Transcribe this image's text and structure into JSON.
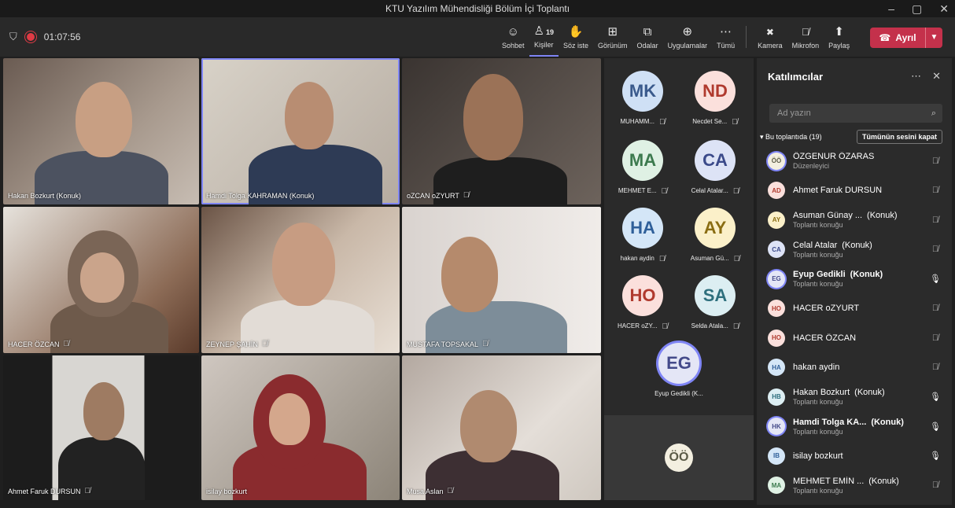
{
  "window": {
    "title": "KTU Yazılım Mühendisliği Bölüm İçi Toplantı"
  },
  "toolbar": {
    "timer": "01:07:56",
    "buttons": [
      {
        "label": "Sohbet",
        "icon": "chat-icon",
        "glyph": "☺"
      },
      {
        "label": "Kişiler",
        "icon": "people-icon",
        "glyph": "♙",
        "count": "19"
      },
      {
        "label": "Söz iste",
        "icon": "hand-icon",
        "glyph": "✋"
      },
      {
        "label": "Görünüm",
        "icon": "view-icon",
        "glyph": "⊞"
      },
      {
        "label": "Odalar",
        "icon": "rooms-icon",
        "glyph": "⧉"
      },
      {
        "label": "Uygulamalar",
        "icon": "apps-icon",
        "glyph": "⊕"
      },
      {
        "label": "Tümü",
        "icon": "more-icon",
        "glyph": "⋯"
      }
    ],
    "media": [
      {
        "label": "Kamera",
        "icon": "camera-off-icon",
        "glyph": "✖"
      },
      {
        "label": "Mikrofon",
        "icon": "mic-off-icon",
        "glyph": "🎙"
      },
      {
        "label": "Paylaş",
        "icon": "share-icon",
        "glyph": "⬆"
      }
    ],
    "leave": "Ayrıl"
  },
  "tiles": [
    {
      "name": "Hakan Bozkurt (Konuk)",
      "muted": false
    },
    {
      "name": "Hamdi Tolga KAHRAMAN (Konuk)",
      "muted": false
    },
    {
      "name": "oZCAN oZYURT",
      "muted": true
    },
    {
      "name": "HACER ÖZCAN",
      "muted": true
    },
    {
      "name": "ZEYNEP ŞAHİN",
      "muted": true
    },
    {
      "name": "MUSTAFA TOPSAKAL",
      "muted": true
    },
    {
      "name": "Ahmet Faruk DURSUN",
      "muted": true
    },
    {
      "name": "isilay bozkurt",
      "muted": false
    },
    {
      "name": "Musa Aslan",
      "muted": true
    }
  ],
  "avatars": [
    {
      "initials": "MK",
      "label": "MUHAMM...",
      "bg": "#cfe0f5",
      "fg": "#3a5a8c"
    },
    {
      "initials": "ND",
      "label": "Necdet Se...",
      "bg": "#fbe0dc",
      "fg": "#b03a2e"
    },
    {
      "initials": "MA",
      "label": "MEHMET E...",
      "bg": "#dff1e4",
      "fg": "#3c7a4e"
    },
    {
      "initials": "CA",
      "label": "Celal Atalar...",
      "bg": "#dde3f6",
      "fg": "#3b4a8a"
    },
    {
      "initials": "HA",
      "label": "hakan aydin",
      "bg": "#d4e6f7",
      "fg": "#2f5f99"
    },
    {
      "initials": "AY",
      "label": "Asuman Gü...",
      "bg": "#fbf0c9",
      "fg": "#8a6d12"
    },
    {
      "initials": "HO",
      "label": "HACER oZY...",
      "bg": "#fbe0dc",
      "fg": "#b03a2e"
    },
    {
      "initials": "SA",
      "label": "Selda Atala...",
      "bg": "#dceef2",
      "fg": "#2e6f7d"
    },
    {
      "initials": "EG",
      "label": "Eyup Gedikli (K...",
      "bg": "#e4e6f6",
      "fg": "#444a8a"
    }
  ],
  "self_tile": {
    "initials": "ÖÖ"
  },
  "panel": {
    "title": "Katılımcılar",
    "search_placeholder": "Ad yazın",
    "section_label": "Bu toplantıda (19)",
    "mute_all": "Tümünün sesini kapat",
    "participants": [
      {
        "initials": "ÖÖ",
        "name": "ÖZGENUR ÖZARAS",
        "tag": "",
        "role": "Düzenleyici",
        "bg": "#f3efe0",
        "fg": "#5b5b47",
        "mic": "muted",
        "bold": false
      },
      {
        "initials": "AD",
        "name": "Ahmet Faruk DURSUN",
        "tag": "",
        "role": "",
        "bg": "#fbe0dc",
        "fg": "#b03a2e",
        "mic": "muted",
        "bold": false
      },
      {
        "initials": "AY",
        "name": "Asuman Günay ...",
        "tag": "(Konuk)",
        "role": "Toplantı konuğu",
        "bg": "#fbf0c9",
        "fg": "#8a6d12",
        "mic": "muted",
        "bold": false
      },
      {
        "initials": "CA",
        "name": "Celal Atalar",
        "tag": "(Konuk)",
        "role": "Toplantı konuğu",
        "bg": "#dde3f6",
        "fg": "#3b4a8a",
        "mic": "muted",
        "bold": false
      },
      {
        "initials": "EG",
        "name": "Eyup Gedikli",
        "tag": "(Konuk)",
        "role": "Toplantı konuğu",
        "bg": "#e4e6f6",
        "fg": "#444a8a",
        "mic": "on",
        "bold": true
      },
      {
        "initials": "HO",
        "name": "HACER oZYURT",
        "tag": "",
        "role": "",
        "bg": "#fbe0dc",
        "fg": "#b03a2e",
        "mic": "muted",
        "bold": false
      },
      {
        "initials": "HO",
        "name": "HACER ÖZCAN",
        "tag": "",
        "role": "",
        "bg": "#fbe0dc",
        "fg": "#b03a2e",
        "mic": "muted",
        "bold": false
      },
      {
        "initials": "HA",
        "name": "hakan aydin",
        "tag": "",
        "role": "",
        "bg": "#d4e6f7",
        "fg": "#2f5f99",
        "mic": "muted",
        "bold": false
      },
      {
        "initials": "HB",
        "name": "Hakan Bozkurt",
        "tag": "(Konuk)",
        "role": "Toplantı konuğu",
        "bg": "#dceef2",
        "fg": "#2e6f7d",
        "mic": "on",
        "bold": false
      },
      {
        "initials": "HK",
        "name": "Hamdi Tolga KA...",
        "tag": "(Konuk)",
        "role": "Toplantı konuğu",
        "bg": "#e4e6f6",
        "fg": "#444a8a",
        "mic": "on",
        "bold": true
      },
      {
        "initials": "IB",
        "name": "isilay bozkurt",
        "tag": "",
        "role": "",
        "bg": "#d4e6f7",
        "fg": "#2f5f99",
        "mic": "on",
        "bold": false
      },
      {
        "initials": "MA",
        "name": "MEHMET EMİN ...",
        "tag": "(Konuk)",
        "role": "Toplantı konuğu",
        "bg": "#dff1e4",
        "fg": "#3c7a4e",
        "mic": "muted",
        "bold": false
      }
    ]
  },
  "colors": {
    "accent": "#7f85f5",
    "leave": "#c4314b",
    "recording": "#e03b45"
  }
}
